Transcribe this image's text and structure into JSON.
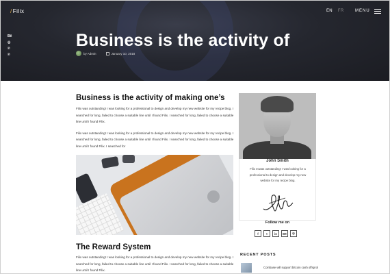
{
  "header": {
    "logo_slash": "/",
    "logo_text": "Filix",
    "lang_active": "EN",
    "lang_inactive": "FR",
    "menu_label": "MENU",
    "social_side": [
      "Bē",
      "◎",
      "℗",
      "℗"
    ]
  },
  "hero": {
    "title": "Business is the activity of",
    "author": "by Admin",
    "date": "January 10, 2018"
  },
  "article": {
    "heading": "Business is the activity of making one’s",
    "paragraph1": "Filix was outstanding! I was looking for a professional to design and develop my new website for my recipe blog. I searched for long, failed to choose a suitable line until I found Filix. I searched for long, failed to choose a suitable line until I found Filix.",
    "paragraph2": "Filix was outstanding! I was looking for a professional to design and develop my new website for my recipe blog. I searched for long, failed to choose a suitable line until I found Filix. I searched for long, failed to choose a suitable line until I found Filix. I searched for",
    "heading2": "The Reward System",
    "paragraph3": "Filix was outstanding! I was looking for a professional to design and develop my new website for my recipe blog. I searched for long, failed to choose a suitable line until I found Filix. I searched for long, failed to choose a suitable line until I found Filix."
  },
  "sidebar": {
    "author_name": "John Smith",
    "author_bio": "Filix ecwas outstanding! I was looking for a professional to design and develop my new website for my recipe blog.",
    "follow_label": "Follow me on",
    "follow_icons": [
      "f",
      "t",
      "in",
      "Bē",
      "◎"
    ],
    "recent_label": "RECENT POSTS",
    "recent_post_title": "Coinbase will support bitcoin cash offsprol"
  },
  "colors": {
    "accent": "#d9a441",
    "hero_bg": "#1f2027"
  }
}
